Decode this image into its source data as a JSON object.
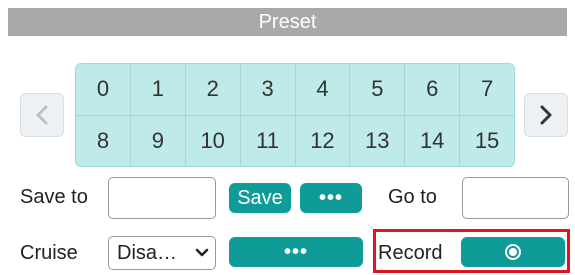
{
  "header": {
    "title": "Preset"
  },
  "presets": [
    "0",
    "1",
    "2",
    "3",
    "4",
    "5",
    "6",
    "7",
    "8",
    "9",
    "10",
    "11",
    "12",
    "13",
    "14",
    "15"
  ],
  "save_row": {
    "save_to_label": "Save to",
    "save_to_value": "",
    "save_button": "Save",
    "more_button": "•••",
    "go_to_label": "Go to",
    "go_to_value": ""
  },
  "cruise_row": {
    "cruise_label": "Cruise",
    "cruise_select_value": "Disa…",
    "more_button": "•••",
    "record_label": "Record"
  },
  "icons": {
    "prev": "chevron-left-icon",
    "next": "chevron-right-icon",
    "select": "chevron-down-icon",
    "record": "radio-icon"
  },
  "colors": {
    "accent": "#0f9c98",
    "preset_cell": "#bfeaea",
    "header_bg": "#a9a9a9",
    "highlight": "#e0141d"
  }
}
